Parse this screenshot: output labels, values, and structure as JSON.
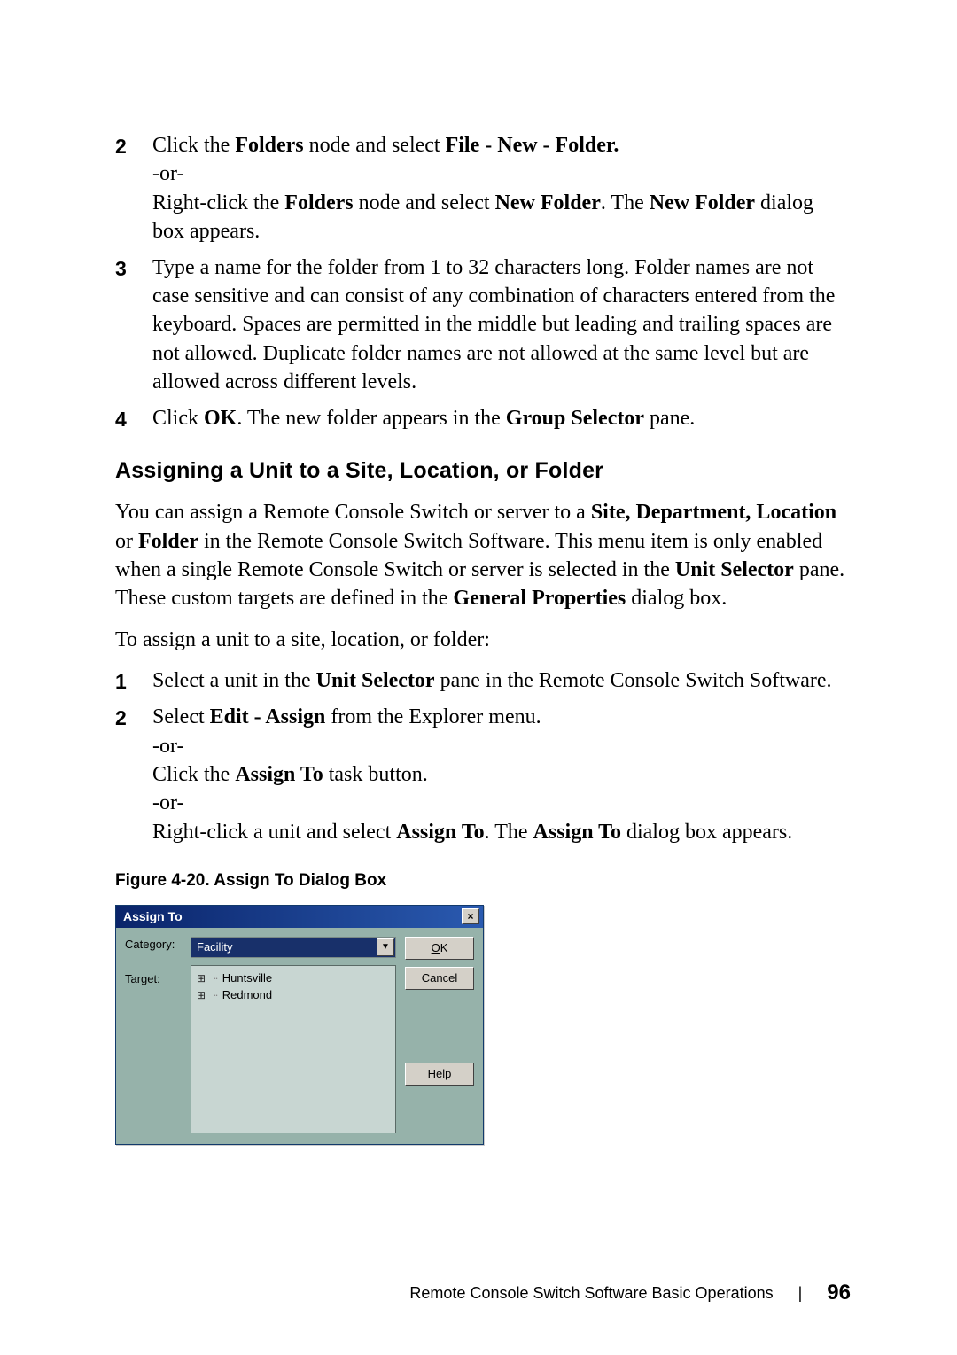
{
  "steps_a": {
    "2": {
      "num": "2",
      "l1a": "Click the ",
      "l1b": "Folders",
      "l1c": " node and select ",
      "l1d": "File - New - Folder.",
      "or": "-or-",
      "l2a": "Right-click the ",
      "l2b": "Folders",
      "l2c": " node and select ",
      "l2d": "New Folder",
      "l2e": ". The ",
      "l2f": "New Folder",
      "l2g": " dialog box appears."
    },
    "3": {
      "num": "3",
      "text": "Type a name for the folder from 1 to 32 characters long. Folder names are not case sensitive and can consist of any combination of characters entered from the keyboard. Spaces are permitted in the middle but leading and trailing spaces are not allowed. Duplicate folder names are not allowed at the same level but are allowed across different levels."
    },
    "4": {
      "num": "4",
      "a": "Click ",
      "b": "OK",
      "c": ". The new folder appears in the ",
      "d": "Group Selector",
      "e": " pane."
    }
  },
  "section_heading": "Assigning a Unit to a Site, Location, or Folder",
  "intro": {
    "a": "You can assign a Remote Console Switch or server to a ",
    "b": "Site, Department, Location",
    "c": " or ",
    "d": "Folder",
    "e": " in the Remote Console Switch Software. This menu item is only enabled when a single Remote Console Switch or server is selected in the ",
    "f": "Unit Selector",
    "g": " pane. These custom targets are defined in the ",
    "h": "General Properties",
    "i": " dialog box."
  },
  "lead": "To assign a unit to a site, location, or folder:",
  "steps_b": {
    "1": {
      "num": "1",
      "a": "Select a unit in the ",
      "b": "Unit Selector",
      "c": " pane in the Remote Console Switch Software."
    },
    "2": {
      "num": "2",
      "l1a": "Select ",
      "l1b": "Edit - Assign",
      "l1c": " from the Explorer menu.",
      "or1": "-or-",
      "l2a": "Click the ",
      "l2b": "Assign To",
      "l2c": " task button.",
      "or2": "-or-",
      "l3a": "Right-click a unit and select ",
      "l3b": "Assign To",
      "l3c": ". The ",
      "l3d": "Assign To",
      "l3e": " dialog box appears."
    }
  },
  "figure_caption": "Figure 4-20.    Assign To Dialog Box",
  "dialog": {
    "title": "Assign To",
    "close_icon": "×",
    "label_category": "Category:",
    "label_target": "Target:",
    "category_value": "Facility",
    "dropdown_glyph": "▼",
    "targets": [
      "Huntsville",
      "Redmond"
    ],
    "buttons": {
      "ok_u": "O",
      "ok_rest": "K",
      "cancel": "Cancel",
      "help_u": "H",
      "help_rest": "elp"
    }
  },
  "footer": {
    "text": "Remote Console Switch Software Basic Operations",
    "page": "96"
  }
}
